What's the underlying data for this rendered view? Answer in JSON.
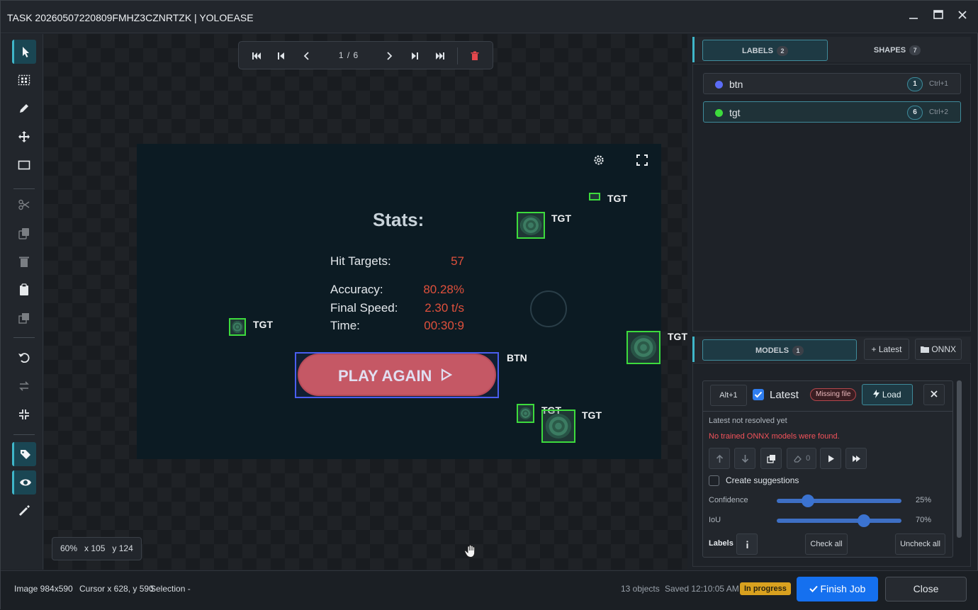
{
  "window": {
    "title": "TASK 20260507220809FMHZ3CZNRTZK | YOLOEASE"
  },
  "nav": {
    "page": "1 / 6"
  },
  "image": {
    "stats_title": "Stats:",
    "rows": [
      {
        "label": "Hit Targets:",
        "value": "57"
      },
      {
        "label": "Accuracy:",
        "value": "80.28%"
      },
      {
        "label": "Final Speed:",
        "value": "2.30 t/s"
      },
      {
        "label": "Time:",
        "value": "00:30:9"
      }
    ],
    "play_again": "PLAY AGAIN",
    "box_labels": {
      "tgt": "TGT",
      "btn": "BTN"
    }
  },
  "canvas": {
    "zoom": "60%",
    "x": "x 105",
    "y": "y 124"
  },
  "labels_panel": {
    "tab_labels": "LABELS",
    "labels_count": "2",
    "tab_shapes": "SHAPES",
    "shapes_count": "7",
    "items": [
      {
        "name": "btn",
        "count": "1",
        "shortcut": "Ctrl+1",
        "color": "#5b6cf6"
      },
      {
        "name": "tgt",
        "count": "6",
        "shortcut": "Ctrl+2",
        "color": "#3ddb3d"
      }
    ]
  },
  "models_panel": {
    "tab": "MODELS",
    "count": "1",
    "latest_btn": "Latest",
    "onnx_btn": "ONNX",
    "shortcut": "Alt+1",
    "model_name": "Latest",
    "missing": "Missing file",
    "load": "Load",
    "status1": "Latest not resolved yet",
    "status2": "No trained ONNX models were found.",
    "erase_count": "0",
    "create_suggestions": "Create suggestions",
    "confidence_label": "Confidence",
    "confidence_value": "25%",
    "confidence": 0.25,
    "iou_label": "IoU",
    "iou_value": "70%",
    "iou": 0.7,
    "labels_label": "Labels",
    "check_all": "Check all",
    "uncheck_all": "Uncheck all"
  },
  "status": {
    "image": "Image 984x590",
    "cursor": "Cursor x 628, y 590",
    "selection": "Selection -",
    "objects": "13 objects",
    "saved": "Saved 12:10:05 AM",
    "badge": "In progress",
    "finish": "Finish Job",
    "close": "Close"
  },
  "colors": {
    "accent": "#3fb6c9",
    "primary": "#1570ef",
    "tgt": "#3ddb3d",
    "btn": "#5b6cf6",
    "danger": "#e0503c"
  }
}
